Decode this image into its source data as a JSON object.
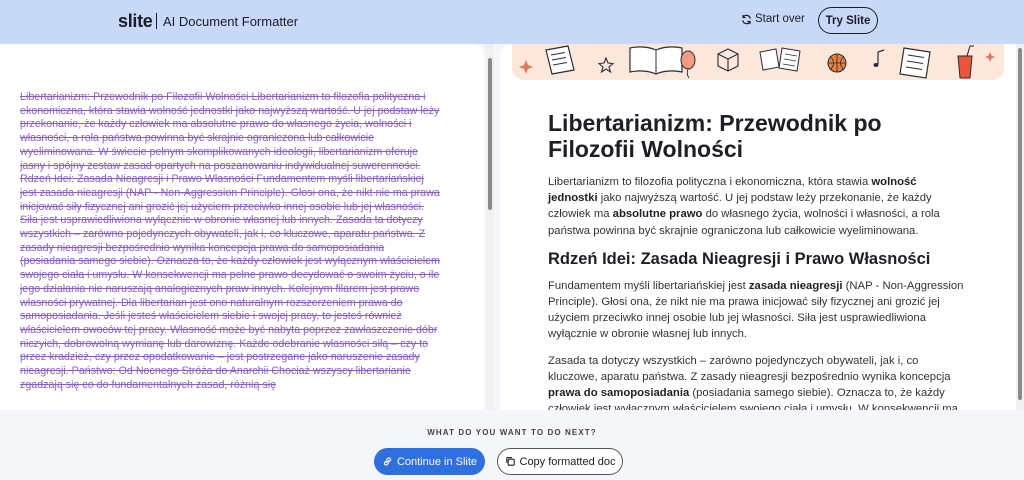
{
  "header": {
    "logo": "slite",
    "title": "AI Document Formatter",
    "start_over": "Start over",
    "try_slite": "Try Slite"
  },
  "source": {
    "text": "Libertarianizm: Przewodnik po Filozofii Wolności Libertarianizm to filozofia polityczna i ekonomiczna, która stawia wolność jednostki jako najwyższą wartość. U jej podstaw leży przekonanie, że każdy człowiek ma absolutne prawo do własnego życia, wolności i własności, a rola państwa powinna być skrajnie ograniczona lub całkowicie wyeliminowana. W świecie pełnym skomplikowanych ideologii, libertarianizm oferuje jasny i spójny zestaw zasad opartych na poszanowaniu indywidualnej suwerenności. Rdzeń Idei: Zasada Nieagresji i Prawo Własności Fundamentem myśli libertariańskiej jest zasada nieagresji (NAP - Non-Aggression Principle). Głosi ona, że nikt nie ma prawa inicjować siły fizycznej ani grozić jej użyciem przeciwko innej osobie lub jej własności. Siła jest usprawiedliwiona wyłącznie w obronie własnej lub innych. Zasada ta dotyczy wszystkich – zarówno pojedynczych obywateli, jak i, co kluczowe, aparatu państwa. Z zasady nieagresji bezpośrednio wynika koncepcja prawa do samoposiadania (posiadania samego siebie). Oznacza to, że każdy człowiek jest wyłącznym właścicielem swojego ciała i umysłu. W konsekwencji ma pełne prawo decydować o swoim życiu, o ile jego działania nie naruszają analogicznych praw innych. Kolejnym filarem jest prawo własności prywatnej. Dla libertarian jest ono naturalnym rozszerzeniem prawa do samoposiadania. Jeśli jesteś właścicielem siebie i swojej pracy, to jesteś również właścicielem owoców tej pracy. Własność może być nabyta poprzez zawłaszczenie dóbr niczyich, dobrowolną wymianę lub darowiznę. Każde odebranie własności siłą – czy to przez kradzież, czy przez opodatkowanie – jest postrzegane jako naruszenie zasady nieagresji. Państwo: Od Nocnego Stróża do Anarchii Chociaż wszyscy libertarianie zgadzają się co do fundamentalnych zasad, różnią się"
  },
  "doc": {
    "title": "Libertarianizm: Przewodnik po Filozofii Wolności",
    "p1_a": "Libertarianizm to filozofia polityczna i ekonomiczna, która stawia ",
    "p1_b1": "wolność jednostki",
    "p1_c": " jako najwyższą wartość. U jej podstaw leży przekonanie, że każdy człowiek ma ",
    "p1_b2": "absolutne prawo",
    "p1_d": " do własnego życia, wolności i własności, a rola państwa powinna być skrajnie ograniczona lub całkowicie wyeliminowana.",
    "h2": "Rdzeń Idei: Zasada Nieagresji i Prawo Własności",
    "p2_a": "Fundamentem myśli libertariańskiej jest ",
    "p2_b": "zasada nieagresji",
    "p2_c": " (NAP - Non-Aggression Principle). Głosi ona, że nikt nie ma prawa inicjować siły fizycznej ani grozić jej użyciem przeciwko innej osobie lub jej własności. Siła jest usprawiedliwiona wyłącznie w obronie własnej lub innych.",
    "p3_a": "Zasada ta dotyczy wszystkich – zarówno pojedynczych obywateli, jak i, co kluczowe, aparatu państwa. Z zasady nieagresji bezpośrednio wynika koncepcja ",
    "p3_b": "prawa do samoposiadania",
    "p3_c": " (posiadania samego siebie). Oznacza to, że każdy człowiek jest wyłącznym właścicielem swojego ciała i umysłu. W konsekwencji ma pełne prawo decydować o swoim życiu, o ile jego działania nie naruszają analogicznych praw innych."
  },
  "footer": {
    "question": "WHAT DO YOU WANT TO DO NEXT?",
    "continue": "Continue in Slite",
    "copy": "Copy formatted doc"
  },
  "colors": {
    "header_bg": "#c7d9f6",
    "strike_text": "#8a5fc4",
    "primary_button": "#2f6fe0",
    "banner_bg": "#fce7db"
  },
  "icons": {
    "start_over": "refresh-icon",
    "continue": "link-icon",
    "copy": "copy-icon"
  }
}
